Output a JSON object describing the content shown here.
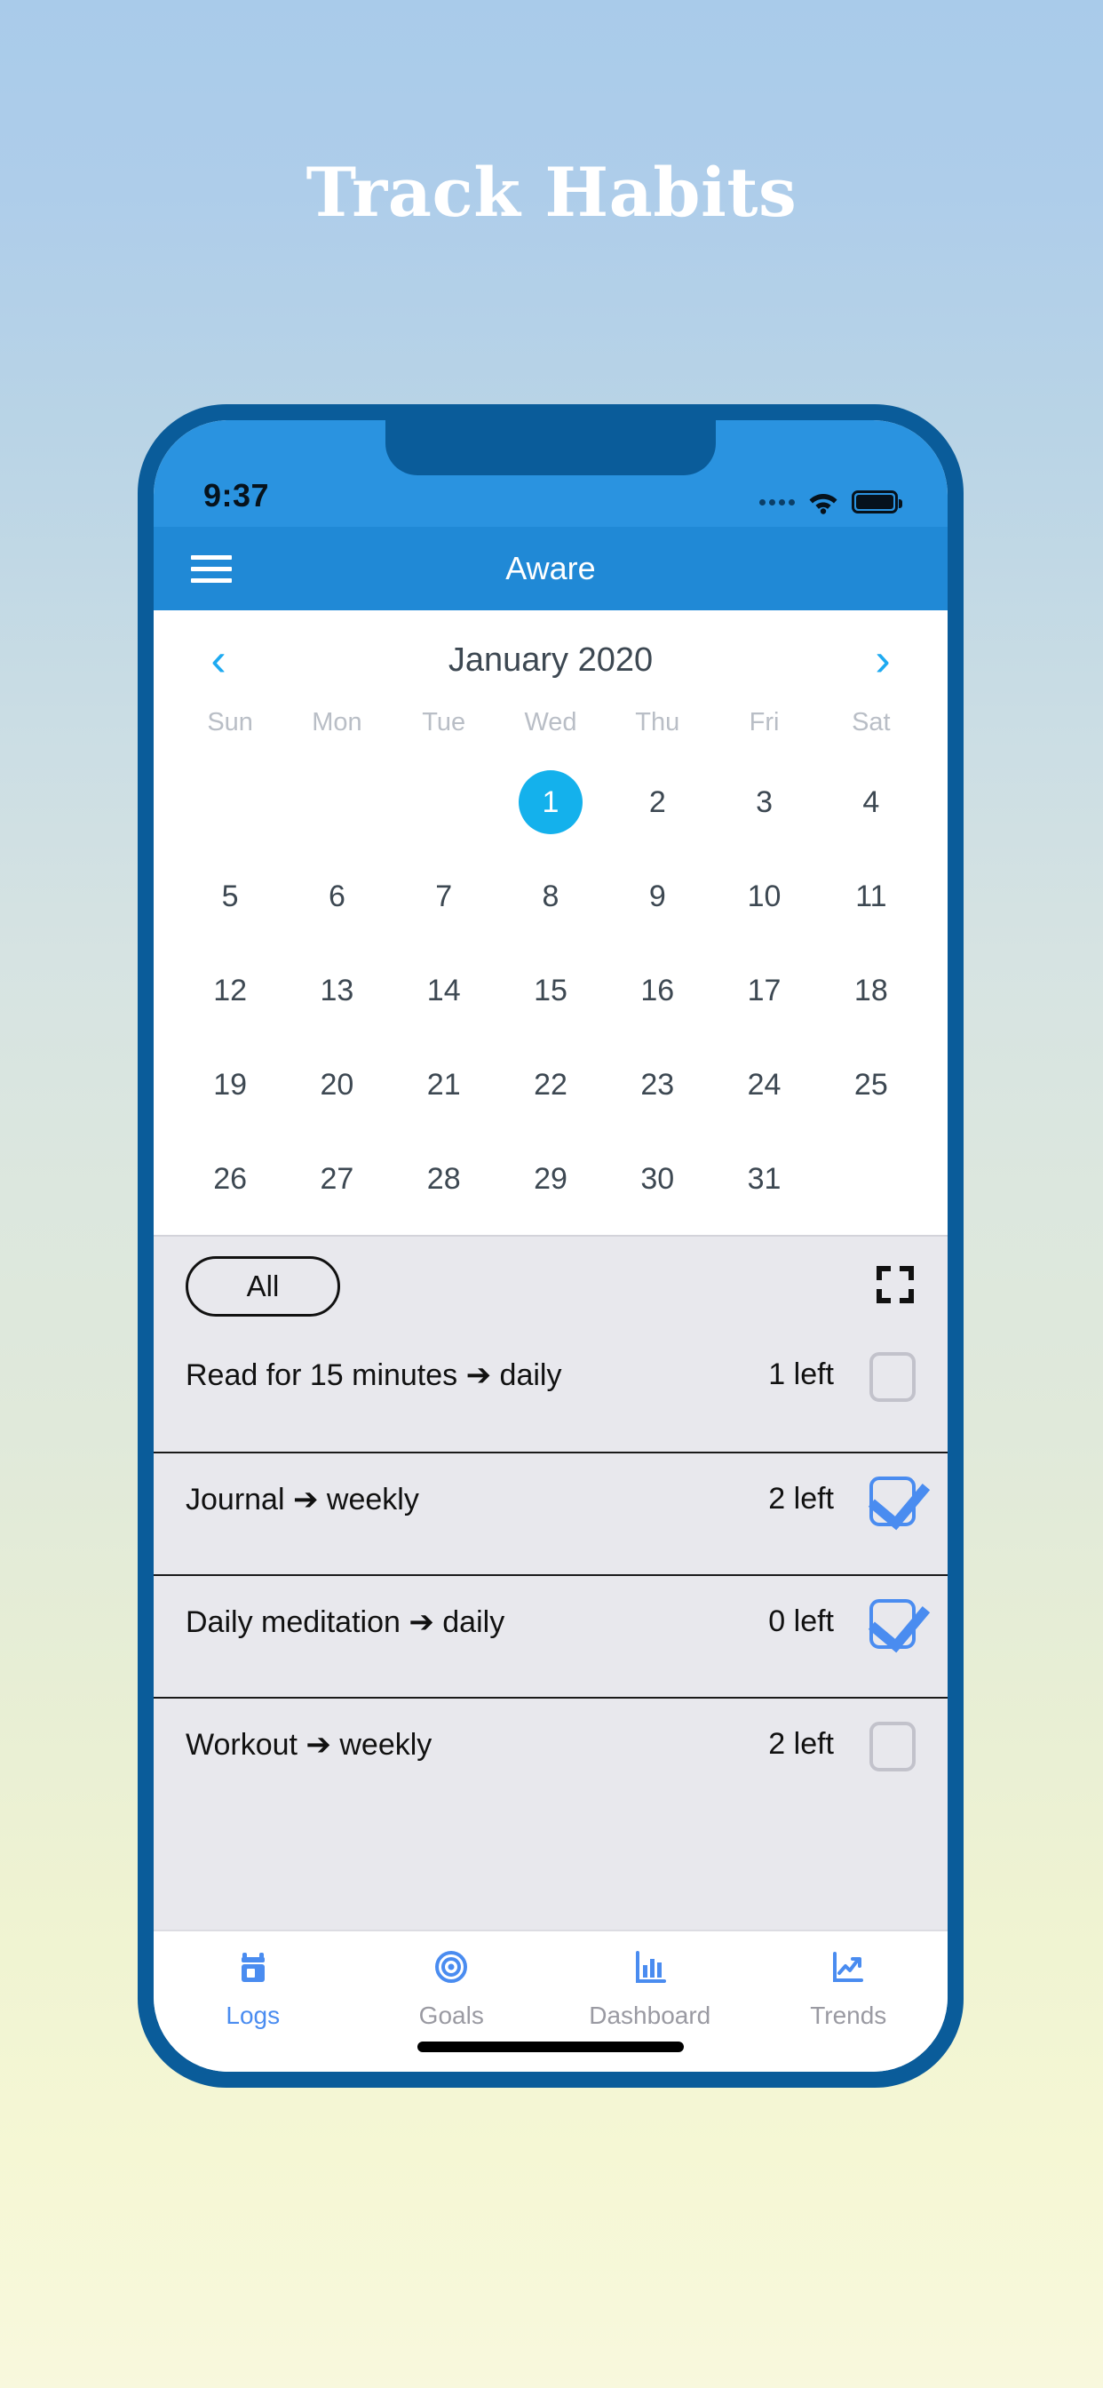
{
  "headline": "Track Habits",
  "phone": {
    "statusbar": {
      "time": "9:37",
      "signal_icon": "signal-dots-icon",
      "wifi_icon": "wifi-icon",
      "battery_icon": "battery-icon"
    },
    "appbar": {
      "menu_icon": "hamburger-menu-icon",
      "title": "Aware"
    },
    "calendar": {
      "prev_icon": "chevron-left-icon",
      "next_icon": "chevron-right-icon",
      "title": "January 2020",
      "weekdays": [
        "Sun",
        "Mon",
        "Tue",
        "Wed",
        "Thu",
        "Fri",
        "Sat"
      ],
      "leading_blanks": 3,
      "days": [
        1,
        2,
        3,
        4,
        5,
        6,
        7,
        8,
        9,
        10,
        11,
        12,
        13,
        14,
        15,
        16,
        17,
        18,
        19,
        20,
        21,
        22,
        23,
        24,
        25,
        26,
        27,
        28,
        29,
        30,
        31
      ],
      "selected_day": 1,
      "selected_color": "#14b1ec"
    },
    "habits": {
      "filter_label": "All",
      "expand_icon": "fullscreen-expand-icon",
      "rows": [
        {
          "name": "Read for 15 minutes ➔ daily",
          "left": "1 left",
          "checked": false
        },
        {
          "name": "Journal ➔ weekly",
          "left": "2 left",
          "checked": true
        },
        {
          "name": "Daily meditation ➔ daily",
          "left": "0 left",
          "checked": true
        },
        {
          "name": "Workout ➔ weekly",
          "left": "2 left",
          "checked": false
        }
      ]
    },
    "bottomnav": {
      "items": [
        {
          "label": "Logs",
          "icon": "calendar-logs-icon",
          "active": true
        },
        {
          "label": "Goals",
          "icon": "target-goals-icon",
          "active": false
        },
        {
          "label": "Dashboard",
          "icon": "bar-chart-dashboard-icon",
          "active": false
        },
        {
          "label": "Trends",
          "icon": "line-chart-trends-icon",
          "active": false
        }
      ]
    },
    "home_indicator": "home-indicator-bar"
  },
  "colors": {
    "accent_blue": "#2089d6",
    "bright_blue": "#14b1ec",
    "nav_blue": "#4a8cf0",
    "bezel": "#0a5c9a",
    "habit_bg": "#e8e8ed"
  }
}
